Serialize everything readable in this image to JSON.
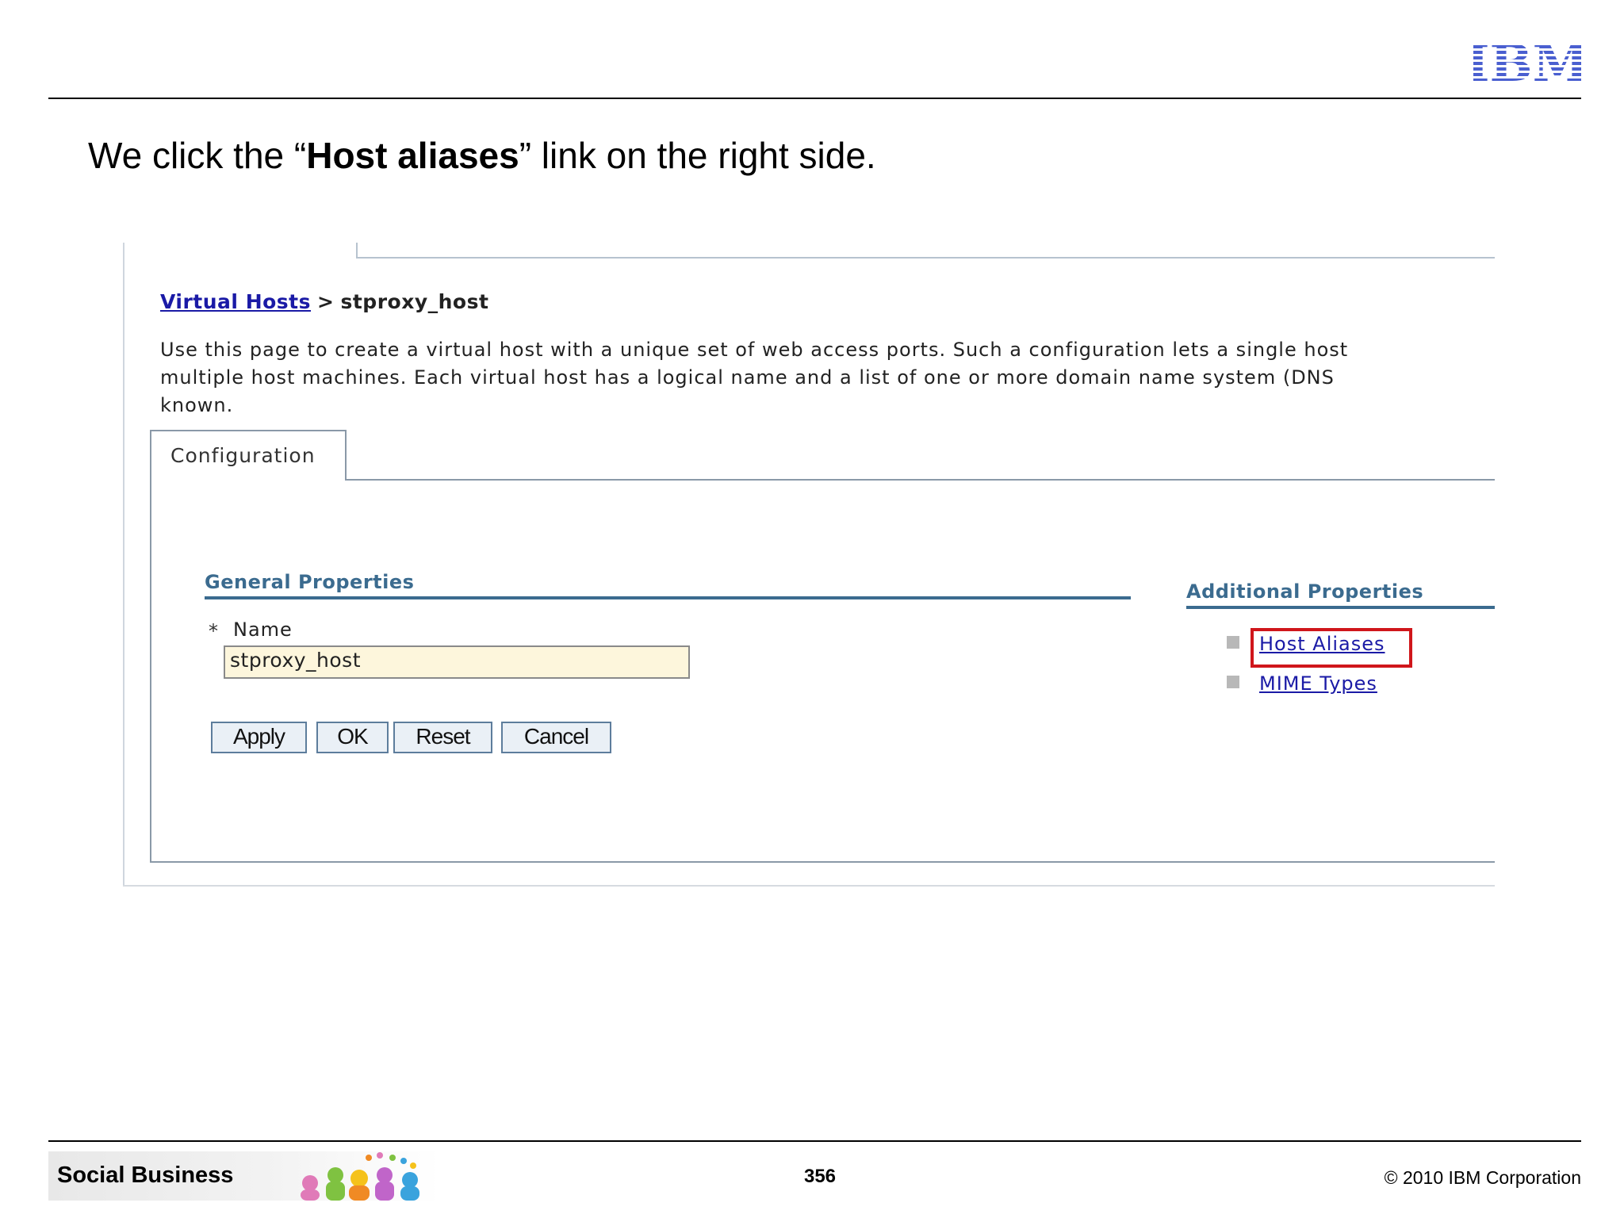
{
  "slide": {
    "logo_text": "IBM",
    "heading_prefix": "We click the “",
    "heading_bold": "Host aliases",
    "heading_suffix": "” link on the right side."
  },
  "console": {
    "breadcrumb": {
      "parent_link": "Virtual Hosts",
      "separator": ">",
      "current": "stproxy_host"
    },
    "description_lines": [
      "Use this page to create a virtual host with a unique set of web access ports. Such a configuration lets a single host",
      "multiple host machines. Each virtual host has a logical name and a list of one or more domain name system (DNS",
      "known."
    ],
    "tab_label": "Configuration",
    "general_properties": {
      "title": "General Properties",
      "required_marker": "*",
      "name_label": "Name",
      "name_value": "stproxy_host"
    },
    "buttons": {
      "apply": "Apply",
      "ok": "OK",
      "reset": "Reset",
      "cancel": "Cancel"
    },
    "additional_properties": {
      "title": "Additional Properties",
      "links": [
        "Host Aliases",
        "MIME Types"
      ],
      "highlight_color": "#d0161b"
    }
  },
  "footer": {
    "brand": "Social Business",
    "page_number": "356",
    "copyright": "© 2010 IBM Corporation"
  },
  "colors": {
    "link": "#1a1aa6",
    "section_title": "#3b6b8f",
    "input_bg": "#fdf6dc",
    "button_bg": "#eaf0f6"
  }
}
